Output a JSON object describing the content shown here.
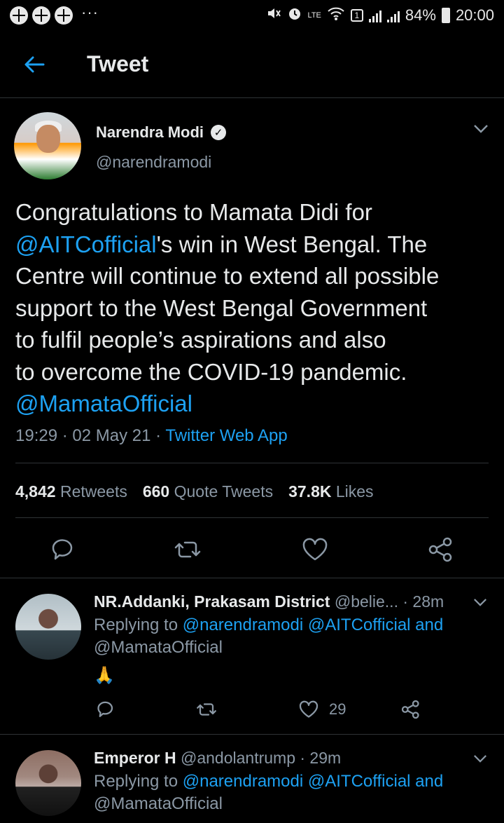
{
  "status_bar": {
    "more": "···",
    "battery": "84%",
    "time": "20:00",
    "network": "LTE",
    "sim": "1"
  },
  "header": {
    "title": "Tweet"
  },
  "tweet": {
    "display_name": "Narendra Modi",
    "handle": "@narendramodi",
    "text_lines": [
      [
        {
          "t": "Congratulations to Mamata Didi for",
          "link": false
        }
      ],
      [
        {
          "t": "@AITCofficial",
          "link": true
        },
        {
          "t": "'s win in West Bengal. The",
          "link": false
        }
      ],
      [
        {
          "t": "Centre will continue to extend all possible",
          "link": false
        }
      ],
      [
        {
          "t": "support to the West Bengal Government",
          "link": false
        }
      ],
      [
        {
          "t": "to fulfil people’s aspirations and also",
          "link": false
        }
      ],
      [
        {
          "t": "to overcome the COVID-19 pandemic.",
          "link": false
        }
      ],
      [
        {
          "t": "@MamataOfficial",
          "link": true
        }
      ]
    ],
    "time": "19:29",
    "date": "02 May 21",
    "source": "Twitter Web App",
    "retweets": "4,842",
    "retweets_label": "Retweets",
    "quotes": "660",
    "quotes_label": "Quote Tweets",
    "likes": "37.8K",
    "likes_label": "Likes",
    "sep": "·"
  },
  "replies": [
    {
      "name": "NR.Addanki, Prakasam District",
      "handle": "@belie...",
      "age": "· 28m",
      "replying_prefix": "Replying to",
      "replying_line1": "@narendramodi @AITCofficial and",
      "replying_line2": "@MamataOfficial",
      "body": "🙏",
      "like_count": "29"
    },
    {
      "name": "Emperor H",
      "handle": "@andolantrump",
      "age": "· 29m",
      "replying_prefix": "Replying to",
      "replying_line1": "@narendramodi @AITCofficial and",
      "replying_line2": "@MamataOfficial"
    }
  ],
  "colors": {
    "accent": "#1da1f2",
    "background": "#000000",
    "secondary_text": "#8b98a5"
  }
}
